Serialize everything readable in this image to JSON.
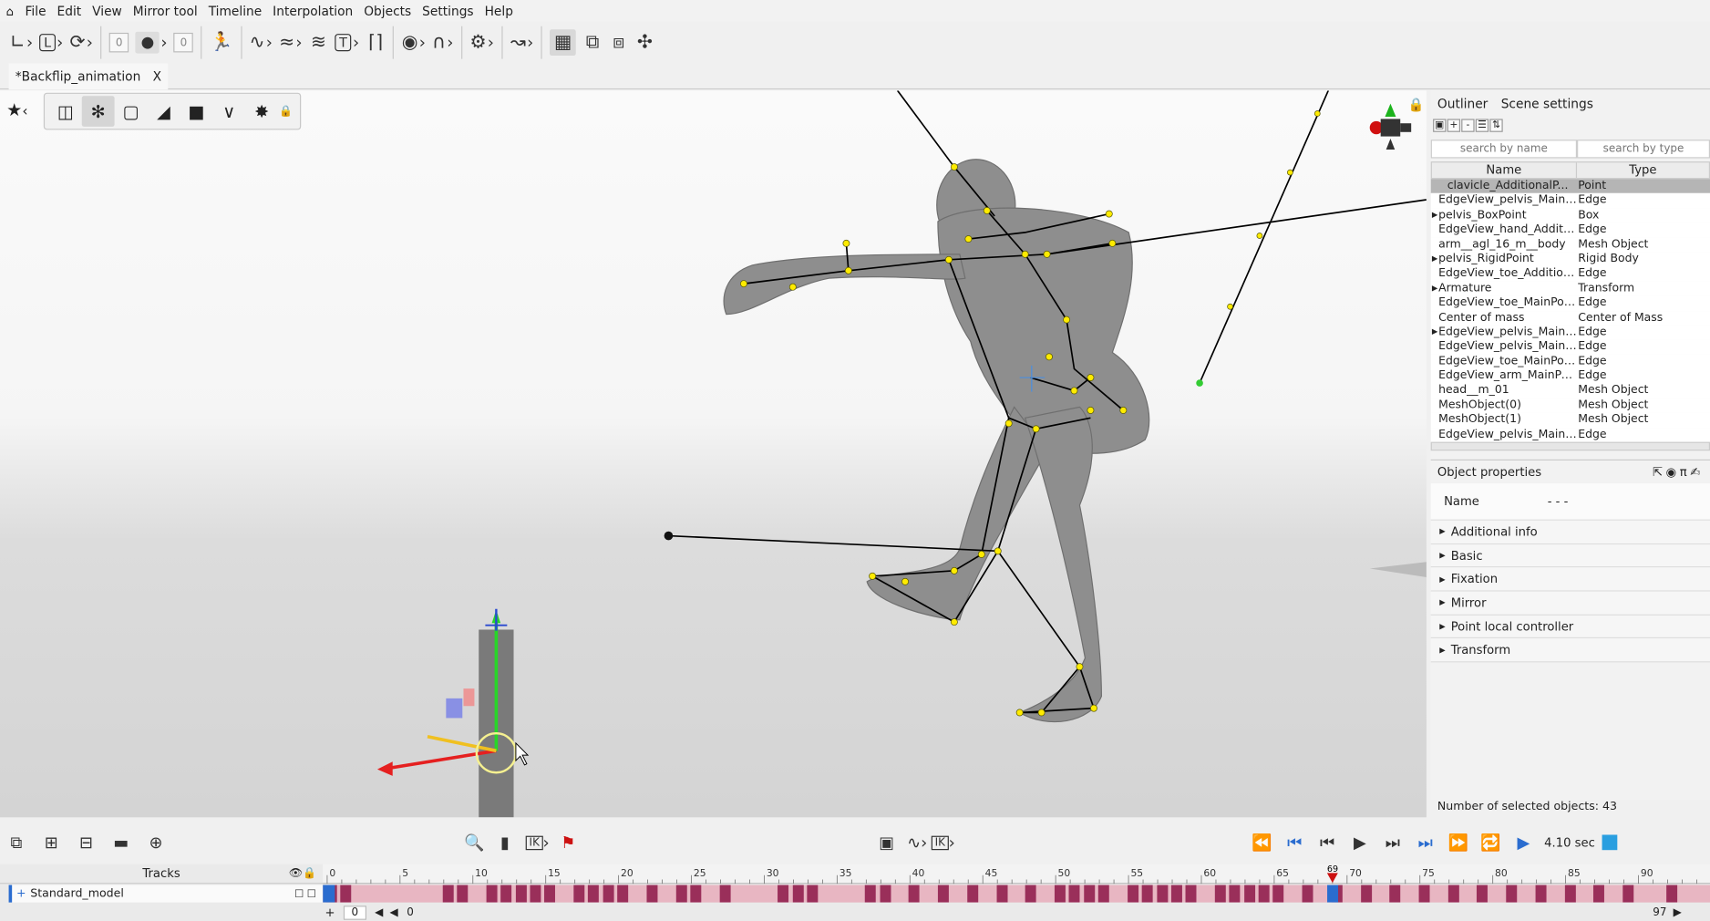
{
  "menu": {
    "items": [
      "File",
      "Edit",
      "View",
      "Mirror tool",
      "Timeline",
      "Interpolation",
      "Objects",
      "Settings",
      "Help"
    ]
  },
  "toolbar": {
    "undo_count": "0",
    "redo_count": "0"
  },
  "document": {
    "tab_title": "*Backflip_animation",
    "close": "X"
  },
  "outliner": {
    "tabs": [
      "Outliner",
      "Scene settings"
    ],
    "search_name_placeholder": "search by name",
    "search_type_placeholder": "search by type",
    "col_name": "Name",
    "col_type": "Type",
    "rows": [
      {
        "name": "clavicle_AdditionalP...",
        "type": "Point",
        "selected": true,
        "expand": false
      },
      {
        "name": "EdgeView_pelvis_MainPoi...",
        "type": "Edge",
        "expand": false
      },
      {
        "name": "pelvis_BoxPoint",
        "type": "Box",
        "expand": true
      },
      {
        "name": "EdgeView_hand_Addition...",
        "type": "Edge",
        "expand": false
      },
      {
        "name": "arm__agl_16_m__body",
        "type": "Mesh Object",
        "expand": false
      },
      {
        "name": "pelvis_RigidPoint",
        "type": "Rigid Body",
        "expand": true
      },
      {
        "name": "EdgeView_toe_Additional...",
        "type": "Edge",
        "expand": false
      },
      {
        "name": "Armature",
        "type": "Transform",
        "expand": true
      },
      {
        "name": "EdgeView_toe_MainPoint...",
        "type": "Edge",
        "expand": false
      },
      {
        "name": "Center of mass",
        "type": "Center of Mass",
        "expand": false
      },
      {
        "name": "EdgeView_pelvis_MainPoi...",
        "type": "Edge",
        "expand": true
      },
      {
        "name": "EdgeView_pelvis_MainPoi...",
        "type": "Edge",
        "expand": false
      },
      {
        "name": "EdgeView_toe_MainPoin...",
        "type": "Edge",
        "expand": false
      },
      {
        "name": "EdgeView_arm_MainPoin...",
        "type": "Edge",
        "expand": false
      },
      {
        "name": "head__m_01",
        "type": "Mesh Object",
        "expand": false
      },
      {
        "name": "MeshObject(0)",
        "type": "Mesh Object",
        "expand": false
      },
      {
        "name": "MeshObject(1)",
        "type": "Mesh Object",
        "expand": false
      },
      {
        "name": "EdgeView_pelvis_MainPoi...",
        "type": "Edge",
        "expand": false
      }
    ]
  },
  "properties": {
    "title": "Object properties",
    "name_label": "Name",
    "name_value": "- - -",
    "sections": [
      "Additional info",
      "Basic",
      "Fixation",
      "Mirror",
      "Point local controller",
      "Transform"
    ]
  },
  "status": {
    "selected": "Number of selected objects: 43"
  },
  "timeline": {
    "duration": "4.10 sec",
    "tracks_label": "Tracks",
    "track_name": "Standard_model",
    "ticks": [
      "0",
      "5",
      "10",
      "15",
      "20",
      "25",
      "30",
      "35",
      "40",
      "45",
      "50",
      "55",
      "60",
      "65",
      "70",
      "75",
      "80",
      "85",
      "90"
    ],
    "current_frame": "69",
    "start_value": "0",
    "offset_value": "0",
    "end_value": "97",
    "keyframe_positions": [
      0,
      1,
      8,
      9,
      11,
      12,
      13,
      14,
      15,
      17,
      18,
      19,
      20,
      22,
      24,
      25,
      27,
      31,
      32,
      33,
      37,
      38,
      40,
      42,
      44,
      46,
      48,
      50,
      51,
      52,
      53,
      55,
      56,
      57,
      58,
      59,
      61,
      62,
      63,
      64,
      65,
      67,
      69,
      71,
      73,
      75,
      77,
      79,
      81,
      83,
      85,
      87,
      89,
      92
    ]
  },
  "colors": {
    "accent": "#2a6ccf",
    "keyframe": "#9a2f5a",
    "strip": "#e8b6c2",
    "playhead": "#cc1111"
  }
}
